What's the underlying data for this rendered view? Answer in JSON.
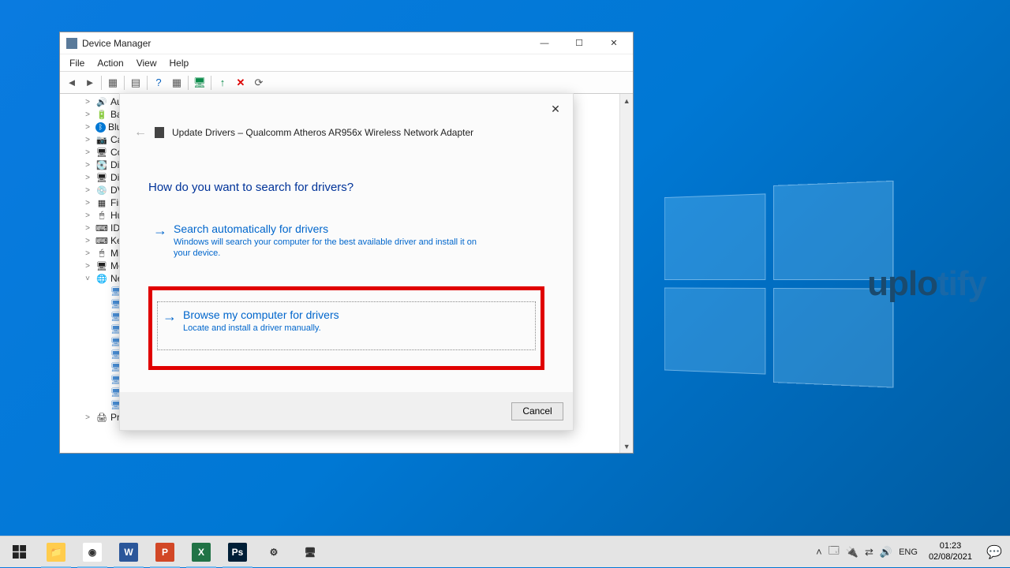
{
  "desktop": {
    "watermark_a": "uplo",
    "watermark_b": "tify"
  },
  "devmgr": {
    "title": "Device Manager",
    "menu": {
      "file": "File",
      "action": "Action",
      "view": "View",
      "help": "Help"
    },
    "tree": [
      {
        "label": "Aud",
        "icon": "🔊"
      },
      {
        "label": "Bat",
        "icon": "🔋"
      },
      {
        "label": "Blu",
        "icon": "ᛒ",
        "color": "#0078d4"
      },
      {
        "label": "Car",
        "icon": "📷"
      },
      {
        "label": "Cor",
        "icon": "🖥"
      },
      {
        "label": "Disl",
        "icon": "💽"
      },
      {
        "label": "Dis",
        "icon": "🖥"
      },
      {
        "label": "DVI",
        "icon": "💿"
      },
      {
        "label": "Firr",
        "icon": "▦"
      },
      {
        "label": "Hur",
        "icon": "🖱"
      },
      {
        "label": "IDE",
        "icon": "⌨"
      },
      {
        "label": "Key",
        "icon": "⌨"
      },
      {
        "label": "Mic",
        "icon": "🖱"
      },
      {
        "label": "Mo",
        "icon": "🖥"
      },
      {
        "label": "Net",
        "icon": "🌐",
        "expanded": true,
        "children": 10
      },
      {
        "label": "Print queues",
        "icon": "🖨"
      }
    ]
  },
  "dialog": {
    "crumb": "Update Drivers – Qualcomm Atheros AR956x Wireless Network Adapter",
    "heading": "How do you want to search for drivers?",
    "opt1": {
      "title": "Search automatically for drivers",
      "desc": "Windows will search your computer for the best available driver and install it on your device."
    },
    "opt2": {
      "title": "Browse my computer for drivers",
      "desc": "Locate and install a driver manually."
    },
    "cancel": "Cancel"
  },
  "taskbar": {
    "apps": [
      {
        "name": "explorer",
        "bg": "#ffcc4d",
        "txt": "📁"
      },
      {
        "name": "chrome",
        "bg": "#fff",
        "txt": "◉"
      },
      {
        "name": "word",
        "bg": "#2b579a",
        "txt": "W"
      },
      {
        "name": "powerpoint",
        "bg": "#d24726",
        "txt": "P"
      },
      {
        "name": "excel",
        "bg": "#217346",
        "txt": "X"
      },
      {
        "name": "photoshop",
        "bg": "#001e36",
        "txt": "Ps"
      },
      {
        "name": "settings",
        "bg": "transparent",
        "txt": "⚙"
      },
      {
        "name": "devmgr",
        "bg": "transparent",
        "txt": "🖥"
      }
    ],
    "lang": "ENG",
    "time": "01:23",
    "date": "02/08/2021"
  }
}
